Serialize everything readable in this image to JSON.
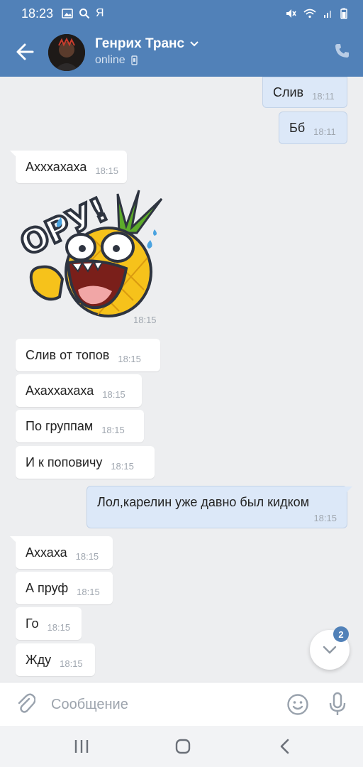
{
  "status": {
    "time": "18:23",
    "extra": "Я"
  },
  "header": {
    "contact_name": "Генрих Транс",
    "subtitle": "online"
  },
  "messages": [
    {
      "id": "m1",
      "dir": "out",
      "text": "Слив",
      "time": "18:11"
    },
    {
      "id": "m2",
      "dir": "out",
      "text": "Бб",
      "time": "18:11"
    },
    {
      "id": "m3",
      "dir": "in",
      "text": "Ахххахаха",
      "time": "18:15"
    },
    {
      "id": "m4",
      "dir": "in",
      "type": "sticker",
      "sticker_text": "ОРУ!",
      "time": "18:15"
    },
    {
      "id": "m5",
      "dir": "in",
      "text": "Слив от топов",
      "time": "18:15"
    },
    {
      "id": "m6",
      "dir": "in",
      "text": "Ахаххахаха",
      "time": "18:15"
    },
    {
      "id": "m7",
      "dir": "in",
      "text": "По группам",
      "time": "18:15"
    },
    {
      "id": "m8",
      "dir": "in",
      "text": "И к поповичу",
      "time": "18:15"
    },
    {
      "id": "m9",
      "dir": "out",
      "text": "Лол,карелин уже давно был кидком",
      "time": "18:15"
    },
    {
      "id": "m10",
      "dir": "in",
      "text": "Аххаха",
      "time": "18:15"
    },
    {
      "id": "m11",
      "dir": "in",
      "text": "А пруф",
      "time": "18:15"
    },
    {
      "id": "m12",
      "dir": "in",
      "text": "Го",
      "time": "18:15"
    },
    {
      "id": "m13",
      "dir": "in",
      "text": "Жду",
      "time": "18:15"
    }
  ],
  "unread_badge": "2",
  "composer": {
    "placeholder": "Сообщение"
  },
  "colors": {
    "header": "#5181b8",
    "background": "#edeef0",
    "outgoing": "#dce8f8",
    "incoming": "#ffffff"
  },
  "icons": [
    "back-arrow-icon",
    "phone-icon",
    "clip-icon",
    "smile-icon",
    "mic-icon",
    "chevron-down-icon"
  ]
}
